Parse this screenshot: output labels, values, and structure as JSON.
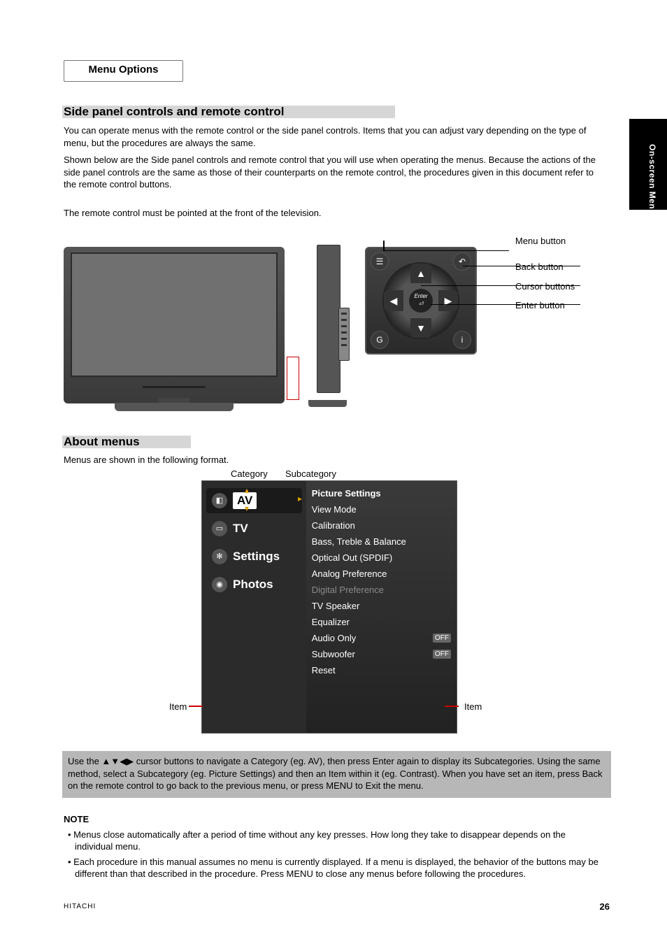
{
  "page_number": "26",
  "brand_footer": "HITACHI",
  "side_tab": "On-screen Menu",
  "menu_tab_label": "Menu Options",
  "headings": {
    "h1": "Side panel controls and remote control",
    "h2": "About menus"
  },
  "intro_paragraphs": {
    "p1": "You can operate menus with the remote control or the side panel controls. Items that you can adjust vary depending on the type of menu, but the procedures are always the same.",
    "p2": "Shown below are the Side panel controls and remote control that you will use when operating the menus. Because the actions of the side panel controls are the same as those of their counterparts on the remote control, the procedures given in this document refer to the remote control buttons.",
    "p3": "The remote control must be pointed at the front of the television."
  },
  "remote_labels": {
    "menu": "Menu button",
    "back": "Back button",
    "cursor": "Cursor buttons",
    "enter": "Enter button"
  },
  "remote_enter_label": "Enter",
  "about_menus": {
    "intro": "Menus are shown in the following format.",
    "cat_label": "Category",
    "sub_label": "Subcategory",
    "item_label": "Item"
  },
  "osd": {
    "categories": [
      {
        "label": "AV",
        "icon": "◧"
      },
      {
        "label": "TV",
        "icon": "▭"
      },
      {
        "label": "Settings",
        "icon": "✻"
      },
      {
        "label": "Photos",
        "icon": "◉"
      }
    ],
    "sub_header": "Picture Settings",
    "items": [
      {
        "label": "View Mode",
        "value": ""
      },
      {
        "label": "Calibration",
        "value": ""
      },
      {
        "label": "Bass, Treble & Balance",
        "value": ""
      },
      {
        "label": "Optical Out (SPDIF)",
        "value": ""
      },
      {
        "label": "Analog Preference",
        "value": ""
      },
      {
        "label": "Digital Preference",
        "value": "",
        "disabled": true
      },
      {
        "label": "TV Speaker",
        "value": ""
      },
      {
        "label": "Equalizer",
        "value": ""
      },
      {
        "label": "Audio Only",
        "value": "OFF"
      },
      {
        "label": "Subwoofer",
        "value": "OFF"
      },
      {
        "label": "Reset",
        "value": ""
      }
    ]
  },
  "nav": {
    "line1_prefix": "Use the ",
    "line1_glyphs": "▲▼◀▶",
    "line1_suffix": " cursor buttons to navigate a Category (eg. AV), then press Enter again to display its Subcategories. Using the same method, select a Subcategory (eg. Picture Settings) and then an Item within it (eg. Contrast). When you have set an item, press Back on the remote control to go back to the previous menu, or press MENU to Exit the menu."
  },
  "note": {
    "heading": "NOTE",
    "b1": "Menus close automatically after a period of time without any key presses. How long they take to disappear depends on the individual menu.",
    "b2": "Each procedure in this manual assumes no menu is currently displayed. If a menu is displayed, the behavior of the buttons may be different than that described in the procedure. Press MENU to close any menus before following the procedures."
  }
}
